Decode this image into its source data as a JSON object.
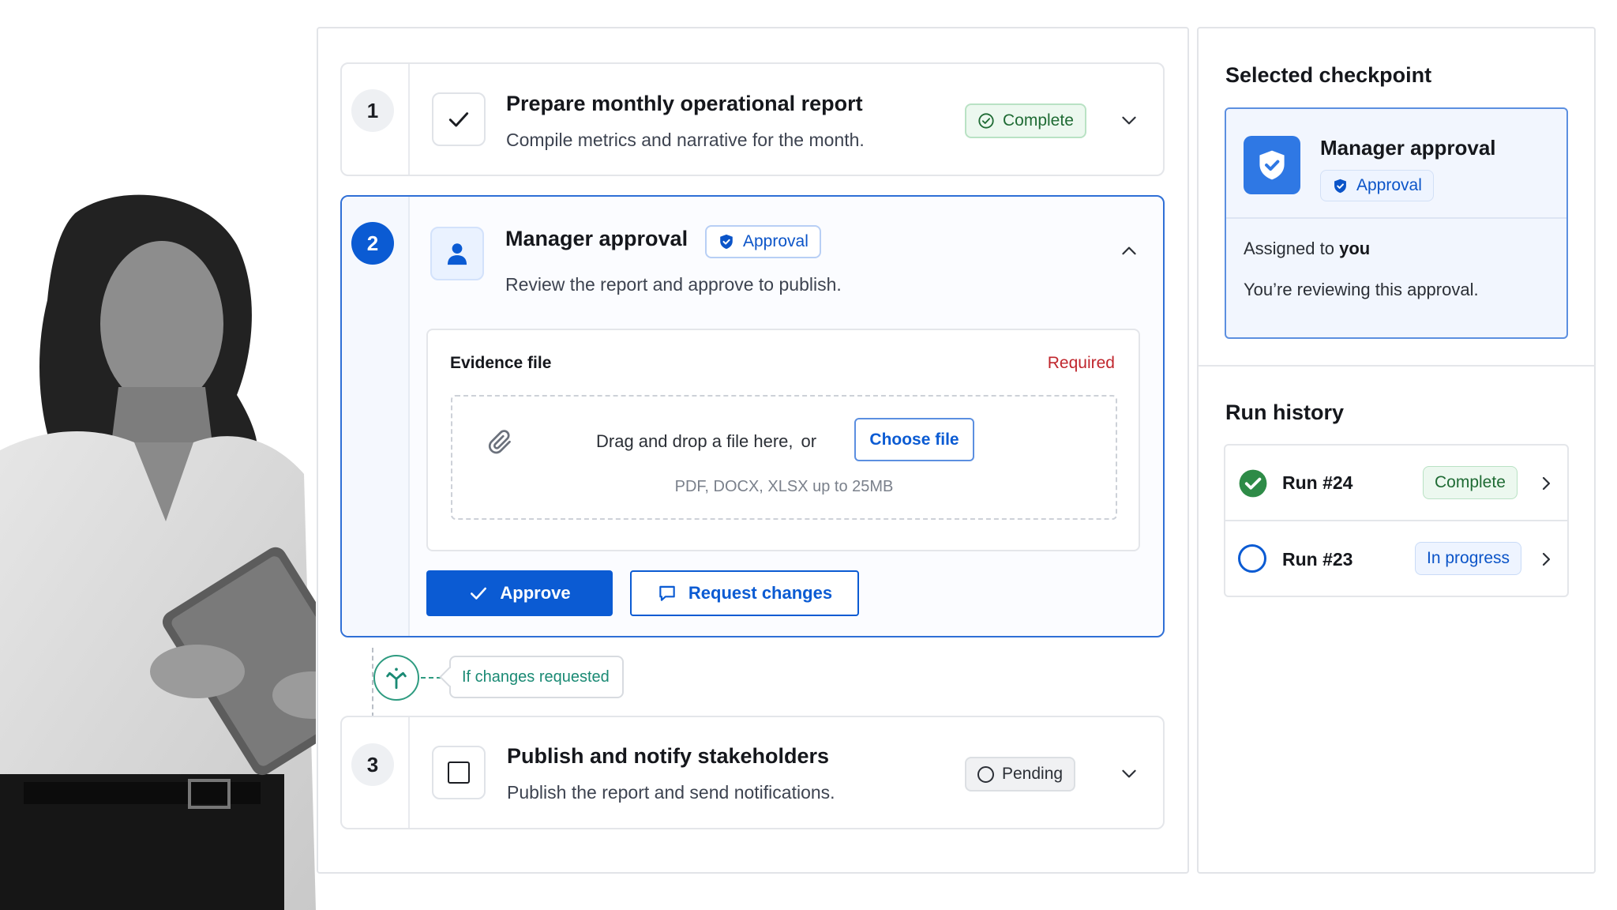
{
  "steps": [
    {
      "number": "1",
      "title": "Prepare monthly operational report",
      "description": "Compile metrics and narrative for the month.",
      "status": "Complete"
    },
    {
      "number": "2",
      "title": "Manager approval",
      "badge": "Approval",
      "description": "Review the report and approve to publish."
    },
    {
      "number": "3",
      "title": "Publish and notify stakeholders",
      "description": "Publish the report and send notifications.",
      "status": "Pending"
    }
  ],
  "evidence": {
    "label": "Evidence file",
    "required": "Required",
    "drop_text": "Drag and drop a file here,",
    "or_text": "or",
    "choose_label": "Choose file",
    "hint": "PDF, DOCX, XLSX up to 25MB"
  },
  "actions": {
    "approve": "Approve",
    "request_changes": "Request changes"
  },
  "branch_label": "If changes requested",
  "selected": {
    "section_title": "Selected checkpoint",
    "name": "Manager approval",
    "badge": "Approval",
    "assigned_prefix": "Assigned to",
    "assigned_user": "you",
    "note": "You’re reviewing this approval."
  },
  "history": {
    "title": "Run history",
    "runs": [
      {
        "name": "Run #24",
        "status": "Complete"
      },
      {
        "name": "Run #23",
        "status": "In progress"
      }
    ]
  },
  "colors": {
    "accent": "#0b5bd3",
    "success": "#2e8b47",
    "danger": "#c0262d",
    "teal": "#1a8a74"
  }
}
